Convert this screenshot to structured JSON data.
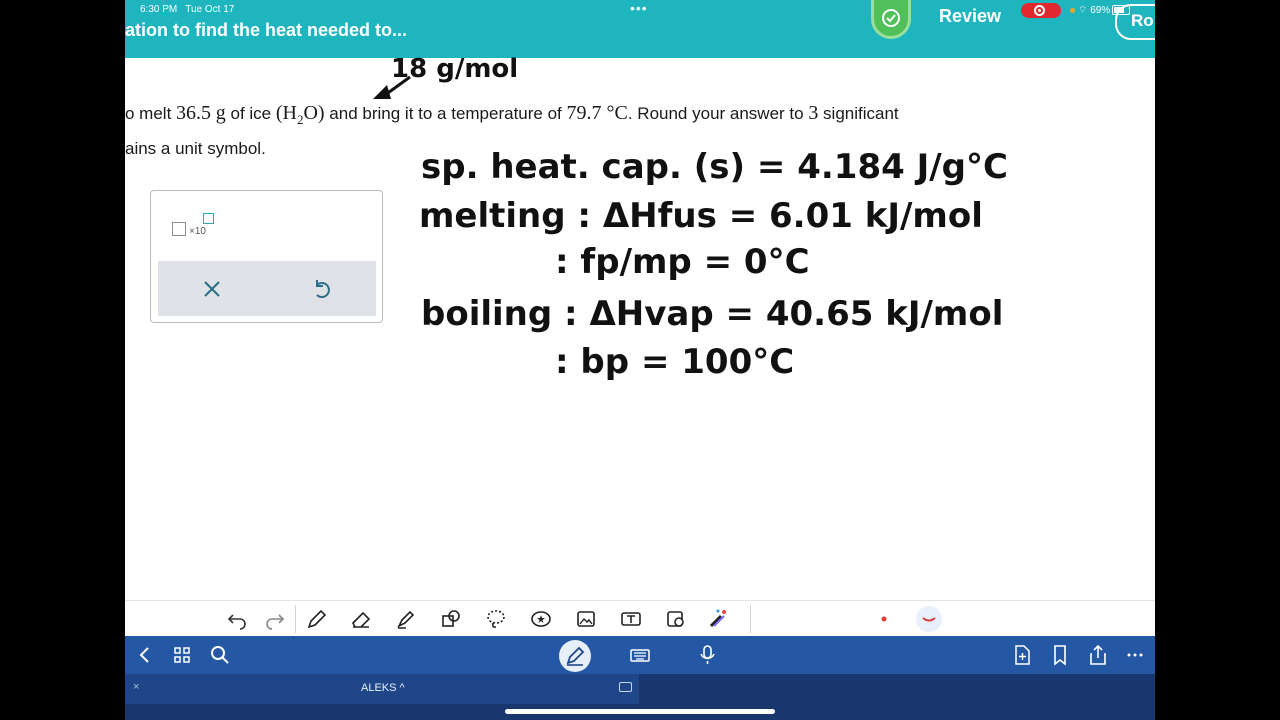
{
  "status_bar": {
    "time": "6:30 PM",
    "date": "Tue Oct 17",
    "battery": "69%"
  },
  "header": {
    "title": "ation to find the heat needed to...",
    "review_label": "Review",
    "right_button": "Ro"
  },
  "question": {
    "line1_a": "o melt ",
    "mass": "36.5",
    "unit_g": "g",
    "line1_b": " of ice ",
    "formula_h": "(H",
    "formula_sub": "2",
    "formula_o": "O)",
    "line1_c": " and bring it to a temperature of ",
    "temp": "79.7 °C",
    "line1_d": ". Round your answer to ",
    "sig": "3",
    "line1_e": " significant",
    "line2": "ains a unit symbol."
  },
  "answer": {
    "x10_label": "×10"
  },
  "handwriting": {
    "molar_mass": "18 g/mol",
    "line1": "sp. heat. cap. (s) = 4.184 J/g°C",
    "line2": "melting : ΔHfus = 6.01 kJ/mol",
    "line3": ": fp/mp = 0°C",
    "line4": "boiling : ΔHvap = 40.65 kJ/mol",
    "line5": ": bp = 100°C"
  },
  "tab": {
    "label": "ALEKS ^",
    "close": "×"
  },
  "colors": {
    "header": "#1fb5bf",
    "app_bar": "#2458a4",
    "tab_bar": "#19366f",
    "check_green": "#52c05a",
    "record_red": "#e0282e"
  },
  "icons": [
    "undo-icon",
    "redo-icon",
    "pen-icon",
    "eraser-icon",
    "highlighter-icon",
    "shapes-icon",
    "lasso-icon",
    "sticker-icon",
    "image-icon",
    "text-icon",
    "scan-icon",
    "magic-icon",
    "back-icon",
    "grid-icon",
    "search-icon",
    "pencil-icon",
    "keyboard-icon",
    "mic-icon",
    "add-page-icon",
    "bookmark-icon",
    "share-icon",
    "more-icon"
  ]
}
